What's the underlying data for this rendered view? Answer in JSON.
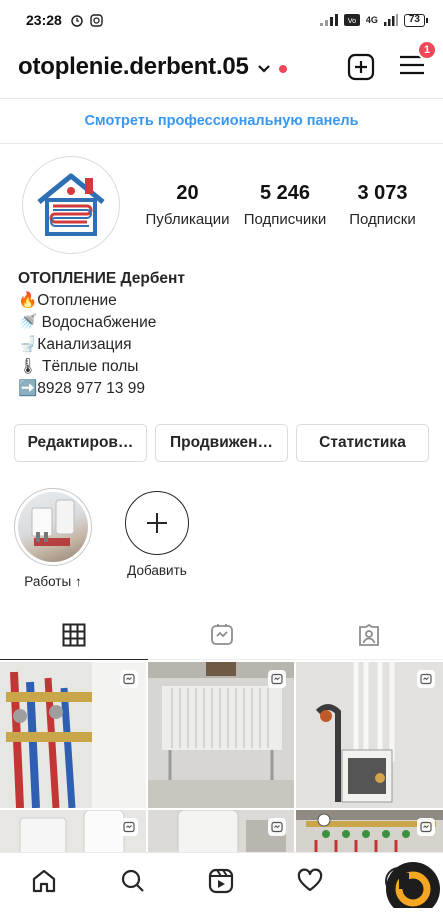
{
  "status_bar": {
    "time": "23:28",
    "battery": "73",
    "network": "4G"
  },
  "header": {
    "username": "otoplenie.derbent.05",
    "notification_count": "1"
  },
  "pro_panel": {
    "label": "Смотреть профессиональную панель"
  },
  "stats": [
    {
      "value": "20",
      "label": "Публикации"
    },
    {
      "value": "5 246",
      "label": "Подписчики"
    },
    {
      "value": "3 073",
      "label": "Подписки"
    }
  ],
  "bio": {
    "name": "ОТОПЛЕНИЕ Дербент",
    "lines": [
      "🔥Отопление",
      "🚿 Водоснабжение",
      "🚽Канализация",
      "🌡 Тёплые полы",
      "➡️8928 977 13 99"
    ]
  },
  "buttons": {
    "edit": "Редактиров…",
    "promote": "Продвижен…",
    "stats": "Статистика"
  },
  "highlights": [
    {
      "label": "Работы ↑"
    },
    {
      "label": "Добавить"
    }
  ],
  "tabs": [
    "grid-icon",
    "reels-icon",
    "tagged-icon"
  ],
  "nav": [
    "home-icon",
    "search-icon",
    "reels-icon",
    "heart-icon",
    "profile-icon"
  ],
  "colors": {
    "accent": "#3897f0",
    "badge": "#ed4956",
    "text": "#262626",
    "border": "#dbdbdb"
  }
}
